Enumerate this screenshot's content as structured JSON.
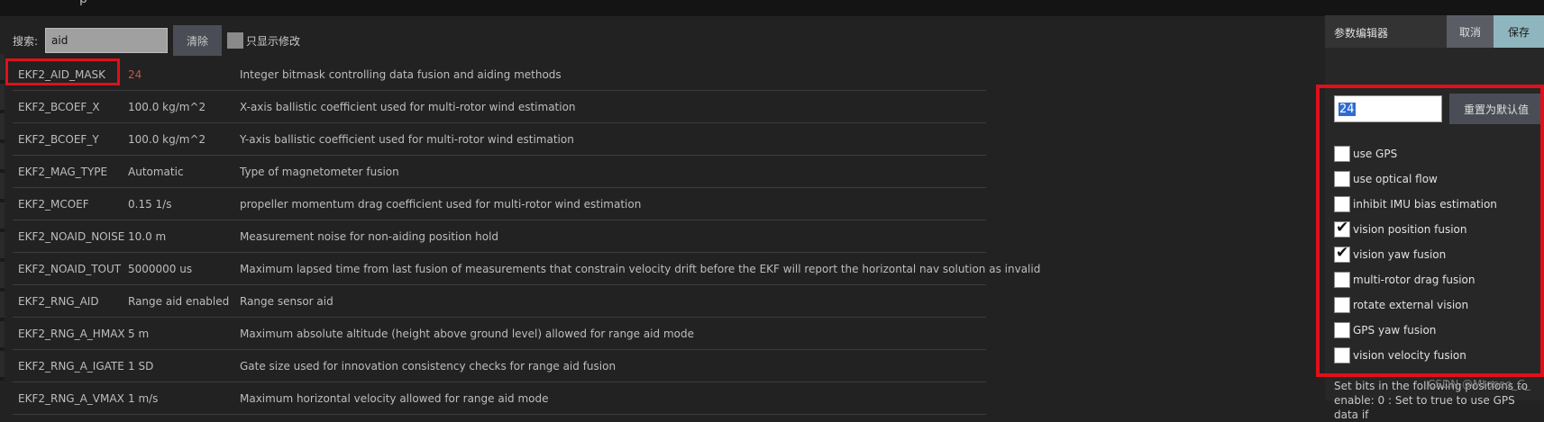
{
  "search": {
    "label": "搜索:",
    "value": "aid",
    "clear_label": "清除",
    "only_modified_label": "只显示修改"
  },
  "params": [
    {
      "name": "EKF2_AID_MASK",
      "value": "24",
      "modified": true,
      "desc": "Integer bitmask controlling data fusion and aiding methods"
    },
    {
      "name": "EKF2_BCOEF_X",
      "value": "100.0 kg/m^2",
      "desc": "X-axis ballistic coefficient used for multi-rotor wind estimation"
    },
    {
      "name": "EKF2_BCOEF_Y",
      "value": "100.0 kg/m^2",
      "desc": "Y-axis ballistic coefficient used for multi-rotor wind estimation"
    },
    {
      "name": "EKF2_MAG_TYPE",
      "value": "Automatic",
      "desc": "Type of magnetometer fusion"
    },
    {
      "name": "EKF2_MCOEF",
      "value": "0.15 1/s",
      "desc": "propeller momentum drag coefficient used for multi-rotor wind estimation"
    },
    {
      "name": "EKF2_NOAID_NOISE",
      "value": "10.0 m",
      "desc": "Measurement noise for non-aiding position hold"
    },
    {
      "name": "EKF2_NOAID_TOUT",
      "value": "5000000 us",
      "desc": "Maximum lapsed time from last fusion of measurements that constrain velocity drift before the EKF will report the horizontal nav solution as invalid"
    },
    {
      "name": "EKF2_RNG_AID",
      "value": "Range aid enabled",
      "desc": "Range sensor aid"
    },
    {
      "name": "EKF2_RNG_A_HMAX",
      "value": "5 m",
      "desc": "Maximum absolute altitude (height above ground level) allowed for range aid mode"
    },
    {
      "name": "EKF2_RNG_A_IGATE",
      "value": "1 SD",
      "desc": "Gate size used for innovation consistency checks for range aid fusion"
    },
    {
      "name": "EKF2_RNG_A_VMAX",
      "value": "1 m/s",
      "desc": "Maximum horizontal velocity allowed for range aid mode"
    }
  ],
  "editor": {
    "title": "参数编辑器",
    "cancel_label": "取消",
    "save_label": "保存",
    "value": "24",
    "reset_label": "重置为默认值",
    "bits": [
      {
        "label": "use GPS",
        "checked": false
      },
      {
        "label": "use optical flow",
        "checked": false
      },
      {
        "label": "inhibit IMU bias estimation",
        "checked": false
      },
      {
        "label": "vision position fusion",
        "checked": true
      },
      {
        "label": "vision yaw fusion",
        "checked": true
      },
      {
        "label": "multi-rotor drag fusion",
        "checked": false
      },
      {
        "label": "rotate external vision",
        "checked": false
      },
      {
        "label": "GPS yaw fusion",
        "checked": false
      },
      {
        "label": "vision velocity fusion",
        "checked": false
      }
    ],
    "help_text": "Set bits in the following positions to enable: 0 : Set to true to use GPS data if"
  },
  "watermark": "CSDN @Mtoseo_C_",
  "colors": {
    "highlight": "#e0101a",
    "modified_value": "#c0564e",
    "save_accent": "#8fb6be"
  }
}
